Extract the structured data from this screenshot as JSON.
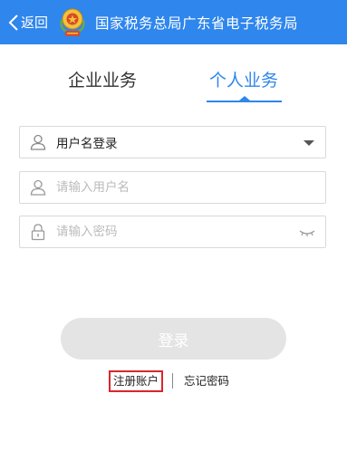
{
  "header": {
    "back_label": "返回",
    "title": "国家税务总局广东省电子税务局",
    "bg_color": "#2f86ec",
    "emblem_icon": "tax-emblem-icon"
  },
  "tabs": [
    {
      "label": "企业业务",
      "active": false
    },
    {
      "label": "个人业务",
      "active": true
    }
  ],
  "login_form": {
    "login_type": {
      "value": "用户名登录",
      "icon": "user-icon"
    },
    "username": {
      "placeholder": "请输入用户名",
      "value": "",
      "icon": "user-icon"
    },
    "password": {
      "placeholder": "请输入密码",
      "value": "",
      "icon": "lock-icon",
      "toggle_icon": "eye-closed-icon"
    },
    "submit_label": "登录"
  },
  "links": {
    "register": "注册账户",
    "forgot_password": "忘记密码"
  },
  "colors": {
    "accent": "#2f86ec",
    "button_disabled": "#e4e4e4",
    "highlight_border": "#d9262c"
  }
}
